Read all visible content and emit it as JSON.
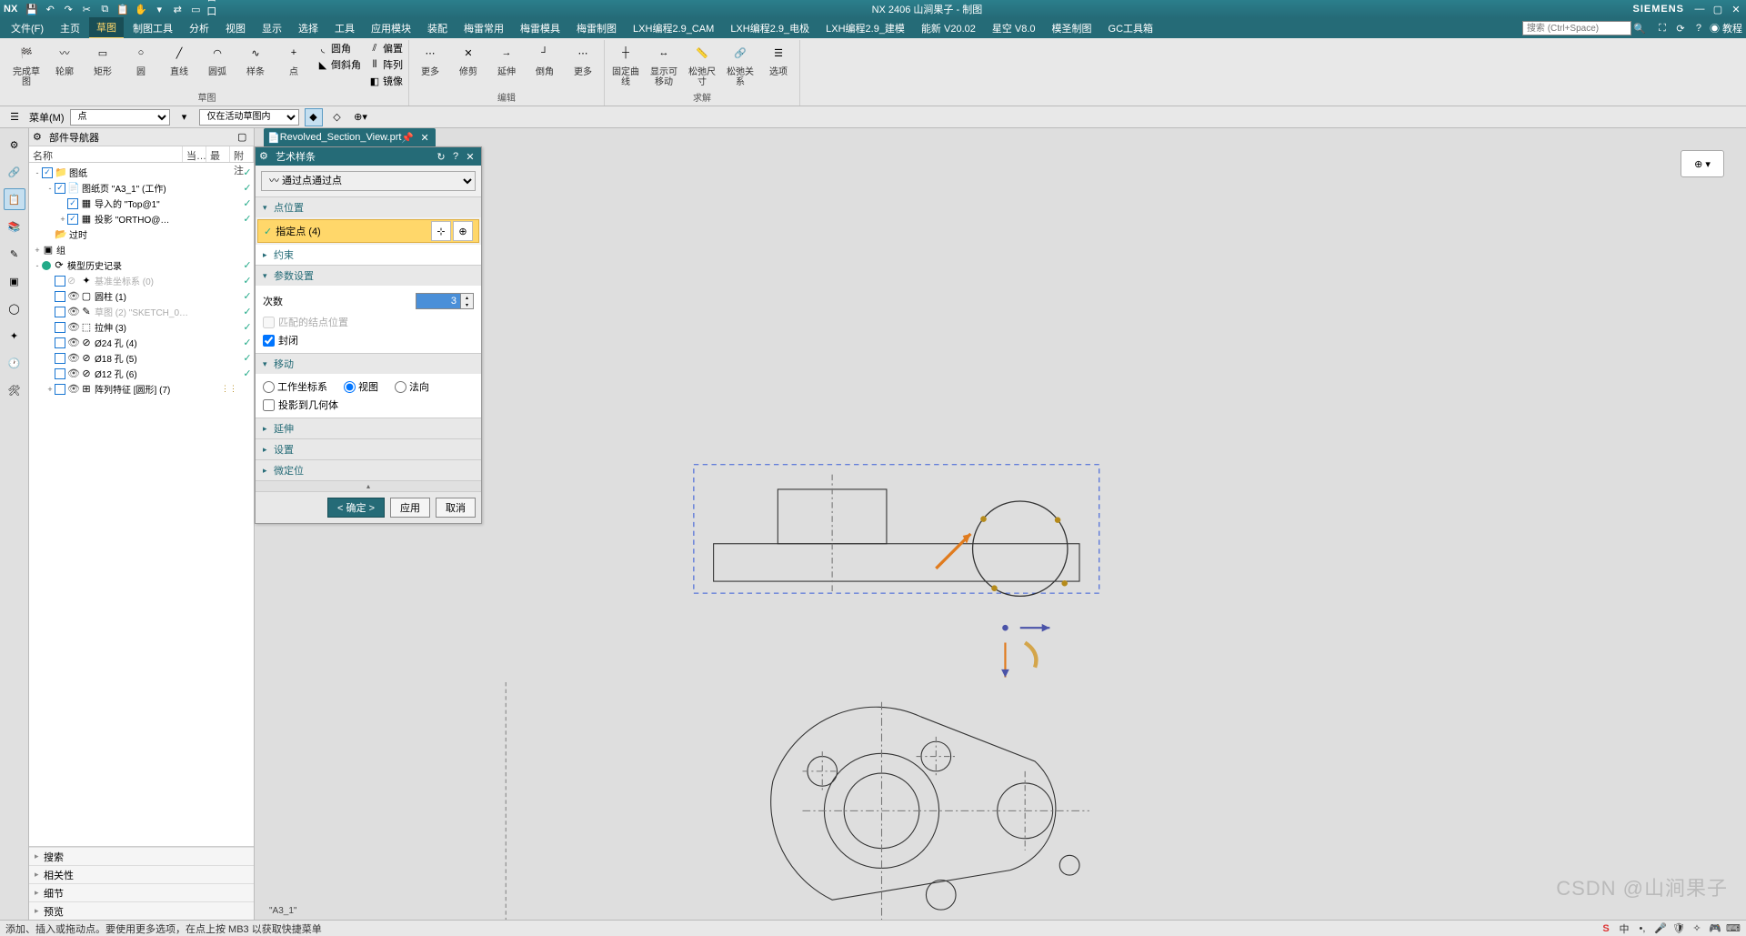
{
  "titlebar": {
    "nx": "NX",
    "center": "NX 2406 山涧果子 - 制图",
    "brand": "SIEMENS"
  },
  "menus": [
    "文件(F)",
    "主页",
    "草图",
    "制图工具",
    "分析",
    "视图",
    "显示",
    "选择",
    "工具",
    "应用模块",
    "装配",
    "梅雷常用",
    "梅雷模具",
    "梅雷制图",
    "LXH编程2.9_CAM",
    "LXH编程2.9_电极",
    "LXH编程2.9_建模",
    "能新 V20.02",
    "星空 V8.0",
    "模圣制图",
    "GC工具箱"
  ],
  "activeMenu": 2,
  "search": {
    "placeholder": "搜索 (Ctrl+Space)"
  },
  "ribbon": {
    "g1": {
      "label": "草图",
      "btns": [
        "完成草图",
        "轮廓",
        "矩形",
        "圆",
        "直线",
        "圆弧",
        "样条",
        "点"
      ],
      "side": [
        "圆角",
        "倒斜角"
      ]
    },
    "g1b": {
      "btns": [
        "偏置",
        "阵列",
        "镜像"
      ]
    },
    "g2": {
      "label": "编辑",
      "btns": [
        "更多",
        "修剪",
        "延伸",
        "倒角",
        "更多"
      ]
    },
    "g3": {
      "label": "求解",
      "btns": [
        "固定曲线",
        "显示可移动",
        "松弛尺寸",
        "松弛关系",
        "选项"
      ]
    }
  },
  "toolbar2": {
    "menu": "菜单(M)",
    "sel1": "点",
    "sel2": "仅在活动草图内"
  },
  "navigator": {
    "title": "部件导航器",
    "cols": [
      "名称",
      "当…",
      "最",
      "附注"
    ],
    "tree": [
      {
        "d": 0,
        "exp": "-",
        "chk": true,
        "icon": "folder",
        "lbl": "图纸",
        "g": true
      },
      {
        "d": 1,
        "exp": "-",
        "chk": true,
        "icon": "sheet",
        "lbl": "图纸页 \"A3_1\" (工作)",
        "g": true
      },
      {
        "d": 2,
        "exp": "",
        "chk": true,
        "icon": "view",
        "lbl": "导入的 \"Top@1\"",
        "g": true
      },
      {
        "d": 2,
        "exp": "+",
        "chk": true,
        "icon": "view",
        "lbl": "投影 \"ORTHO@…",
        "g": true
      },
      {
        "d": 1,
        "exp": "",
        "chk": false,
        "icon": "folder-q",
        "lbl": "过时",
        "g": false,
        "noCheck": true
      },
      {
        "d": 0,
        "exp": "+",
        "chk": false,
        "icon": "group",
        "lbl": "组",
        "g": false,
        "noCheck": true
      },
      {
        "d": 0,
        "exp": "-",
        "chk": false,
        "icon": "history",
        "lbl": "模型历史记录",
        "g": true,
        "greenDot": true,
        "noCheck": true
      },
      {
        "d": 1,
        "exp": "",
        "icon": "csys",
        "lbl": "基准坐标系 (0)",
        "g": true,
        "dis": true,
        "eye": "off"
      },
      {
        "d": 1,
        "exp": "",
        "icon": "cyl",
        "lbl": "圆柱 (1)",
        "g": true,
        "eye": "on"
      },
      {
        "d": 1,
        "exp": "",
        "icon": "sketch",
        "lbl": "草图 (2) \"SKETCH_0…",
        "g": true,
        "eye": "on",
        "dis": true
      },
      {
        "d": 1,
        "exp": "",
        "icon": "extrude",
        "lbl": "拉伸 (3)",
        "g": true,
        "eye": "on"
      },
      {
        "d": 1,
        "exp": "",
        "icon": "hole",
        "lbl": "Ø24 孔 (4)",
        "g": true,
        "eye": "on"
      },
      {
        "d": 1,
        "exp": "",
        "icon": "hole",
        "lbl": "Ø18 孔 (5)",
        "g": true,
        "eye": "on"
      },
      {
        "d": 1,
        "exp": "",
        "icon": "hole",
        "lbl": "Ø12 孔 (6)",
        "g": true,
        "eye": "on"
      },
      {
        "d": 1,
        "exp": "+",
        "icon": "pattern",
        "lbl": "阵列特征 [圆形] (7)",
        "g": false,
        "eye": "on",
        "extra": "⋮⋮"
      }
    ],
    "sections": [
      "搜索",
      "相关性",
      "细节",
      "预览"
    ]
  },
  "tab": {
    "label": "Revolved_Section_View.prt",
    "pin": "📌"
  },
  "dialog": {
    "title": "艺术样条",
    "method": "通过点",
    "sec_point": "点位置",
    "specify": "指定点 (4)",
    "sec_constraint": "约束",
    "sec_param": "参数设置",
    "degree_lbl": "次数",
    "degree_val": "3",
    "match_lbl": "匹配的结点位置",
    "close_lbl": "封闭",
    "sec_move": "移动",
    "radios": [
      "工作坐标系",
      "视图",
      "法向"
    ],
    "proj_lbl": "投影到几何体",
    "sec_ext": "延伸",
    "sec_set": "设置",
    "sec_micro": "微定位",
    "ok": "< 确定 >",
    "apply": "应用",
    "cancel": "取消"
  },
  "sheet": "\"A3_1\"",
  "status": "添加、插入或拖动点。要使用更多选项，在点上按 MB3 以获取快捷菜单",
  "watermark": "CSDN @山涧果子"
}
